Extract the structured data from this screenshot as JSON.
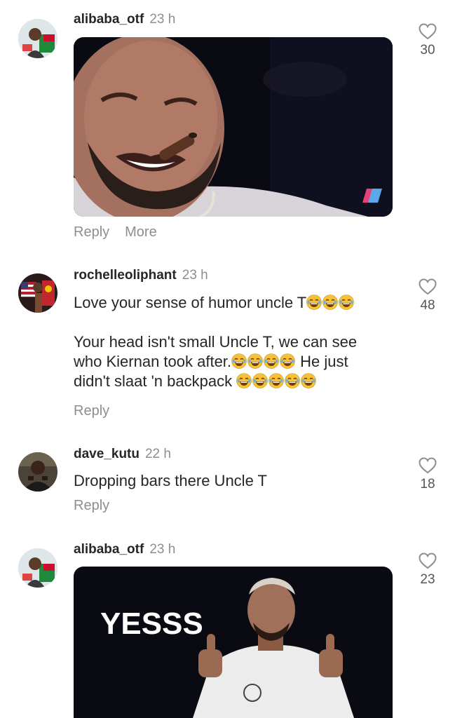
{
  "comments": [
    {
      "username": "alibaba_otf",
      "time": "23 h",
      "likes": "30",
      "actions": {
        "reply": "Reply",
        "more": "More"
      }
    },
    {
      "username": "rochelleoliphant",
      "time": "23 h",
      "likes": "48",
      "line1": "Love your sense of humor uncle T",
      "line2": "Your head isn't small Uncle T, we can see",
      "line3a": "who Kiernan took after.",
      "line3b": " He just",
      "line4": "didn't slaat 'n backpack",
      "actions": {
        "reply": "Reply"
      }
    },
    {
      "username": "dave_kutu",
      "time": "22 h",
      "likes": "18",
      "text": "Dropping bars there Uncle T",
      "actions": {
        "reply": "Reply"
      }
    },
    {
      "username": "alibaba_otf",
      "time": "23 h",
      "likes": "23",
      "gif_caption": "YESSS"
    }
  ],
  "icons": {
    "like": "heart-outline-icon",
    "emoji": "tears-of-joy-emoji"
  },
  "colors": {
    "username": "#262626",
    "meta": "#8e8e8e",
    "gif_bg": "#0a0a12"
  }
}
